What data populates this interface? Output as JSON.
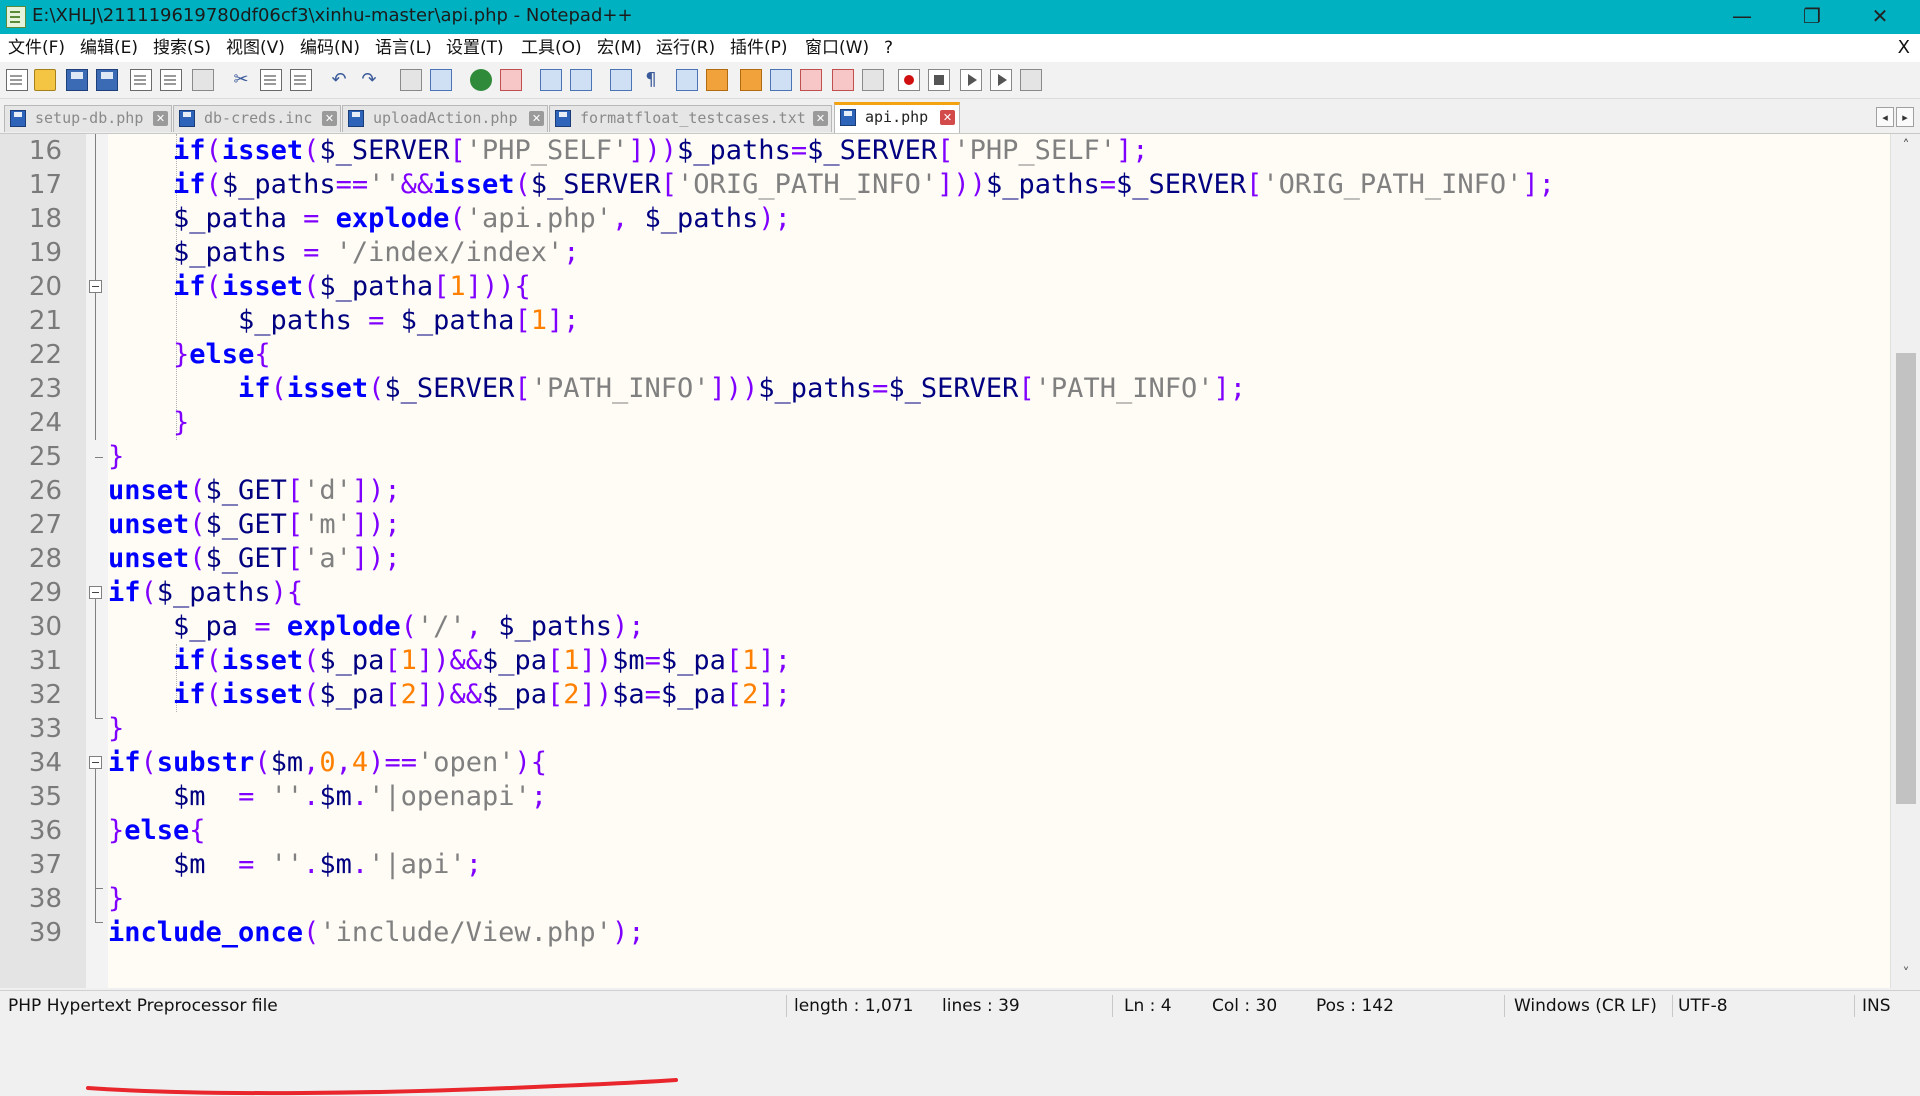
{
  "window": {
    "title": "E:\\XHLJ\\211119619780df06cf3\\xinhu-master\\api.php - Notepad++",
    "minimize_glyph": "—",
    "maximize_glyph": "❐",
    "close_glyph": "✕"
  },
  "menu": {
    "items": [
      "文件(F)",
      "编辑(E)",
      "搜索(S)",
      "视图(V)",
      "编码(N)",
      "语言(L)",
      "设置(T)",
      "工具(O)",
      "宏(M)",
      "运行(R)",
      "插件(P)",
      "窗口(W)",
      "?"
    ],
    "close_glyph": "X"
  },
  "toolbar": {
    "icons": [
      "new-file-icon",
      "open-file-icon",
      "save-icon",
      "save-all-icon",
      "close-file-icon",
      "close-all-icon",
      "print-icon",
      "cut-icon",
      "copy-icon",
      "paste-icon",
      "undo-icon",
      "redo-icon",
      "find-icon",
      "replace-icon",
      "zoom-in-icon",
      "zoom-out-icon",
      "sync-vertical-icon",
      "sync-horizontal-icon",
      "word-wrap-icon",
      "show-all-chars-icon",
      "indent-guide-icon",
      "doc-map-icon",
      "function-list-icon",
      "folder-workspace-icon",
      "doc-list-icon",
      "monitor-icon",
      "eye-icon",
      "record-macro-icon",
      "stop-macro-icon",
      "play-macro-icon",
      "run-macro-multiple-icon",
      "save-macro-icon"
    ],
    "undo_glyph": "↶",
    "redo_glyph": "↷",
    "pilcrow_glyph": "¶"
  },
  "tabs": [
    {
      "label": "setup-db.php",
      "active": false
    },
    {
      "label": "db-creds.inc",
      "active": false
    },
    {
      "label": "uploadAction.php",
      "active": false
    },
    {
      "label": "formatfloat_testcases.txt",
      "active": false
    },
    {
      "label": "api.php",
      "active": true
    }
  ],
  "tab_close_glyph": "✕",
  "tab_nav": {
    "left": "◂",
    "right": "▸"
  },
  "editor": {
    "lines": [
      {
        "n": "16",
        "code": "    if(isset($_SERVER['PHP_SELF']))$_paths=$_SERVER['PHP_SELF'];"
      },
      {
        "n": "17",
        "code": "    if($_paths==''&&isset($_SERVER['ORIG_PATH_INFO']))$_paths=$_SERVER['ORIG_PATH_INFO'];"
      },
      {
        "n": "18",
        "code": "    $_patha = explode('api.php', $_paths);"
      },
      {
        "n": "19",
        "code": "    $_paths = '/index/index';"
      },
      {
        "n": "20",
        "code": "    if(isset($_patha[1])){"
      },
      {
        "n": "21",
        "code": "        $_paths = $_patha[1];"
      },
      {
        "n": "22",
        "code": "    }else{"
      },
      {
        "n": "23",
        "code": "        if(isset($_SERVER['PATH_INFO']))$_paths=$_SERVER['PATH_INFO'];"
      },
      {
        "n": "24",
        "code": "    }"
      },
      {
        "n": "25",
        "code": "}"
      },
      {
        "n": "26",
        "code": "unset($_GET['d']);"
      },
      {
        "n": "27",
        "code": "unset($_GET['m']);"
      },
      {
        "n": "28",
        "code": "unset($_GET['a']);"
      },
      {
        "n": "29",
        "code": "if($_paths){"
      },
      {
        "n": "30",
        "code": "    $_pa = explode('/', $_paths);"
      },
      {
        "n": "31",
        "code": "    if(isset($_pa[1])&&$_pa[1])$m=$_pa[1];"
      },
      {
        "n": "32",
        "code": "    if(isset($_pa[2])&&$_pa[2])$a=$_pa[2];"
      },
      {
        "n": "33",
        "code": "}"
      },
      {
        "n": "34",
        "code": "if(substr($m,0,4)=='open'){"
      },
      {
        "n": "35",
        "code": "    $m  = ''.$m.'|openapi';"
      },
      {
        "n": "36",
        "code": "}else{"
      },
      {
        "n": "37",
        "code": "    $m  = ''.$m.'|api';"
      },
      {
        "n": "38",
        "code": "}"
      },
      {
        "n": "39",
        "code": "include_once('include/View.php');"
      }
    ],
    "scroll_up_glyph": "˄",
    "scroll_down_glyph": "˅",
    "annotation_color": "#e8262c"
  },
  "status": {
    "file_type": "PHP Hypertext Preprocessor file",
    "length": "length : 1,071",
    "lines": "lines : 39",
    "ln": "Ln : 4",
    "col": "Col : 30",
    "pos": "Pos : 142",
    "eol": "Windows (CR LF)",
    "encoding": "UTF-8",
    "mode": "INS"
  }
}
